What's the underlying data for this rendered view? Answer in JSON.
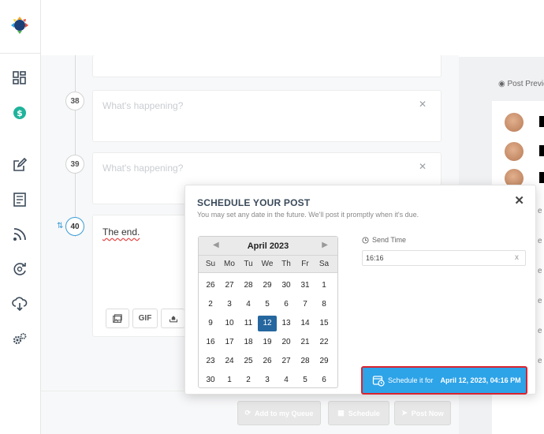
{
  "sidebar": {
    "icons": [
      "app-logo-icon",
      "dashboard-icon",
      "dollar-icon",
      "compose-icon",
      "queue-icon",
      "rss-icon",
      "recycle-icon",
      "cloud-download-icon",
      "settings-icon"
    ]
  },
  "posts": [
    {
      "number": "38",
      "placeholder": "What's happening?",
      "text": ""
    },
    {
      "number": "39",
      "placeholder": "What's happening?",
      "text": ""
    },
    {
      "number": "40",
      "placeholder": "",
      "text": "The end."
    }
  ],
  "composer_tools": {
    "gif_label": "GIF"
  },
  "bottom_actions": {
    "queue_label": "Add to my Queue",
    "schedule_label": "Schedule",
    "post_now_label": "Post Now"
  },
  "preview": {
    "title": "Post Preview"
  },
  "modal": {
    "title": "SCHEDULE YOUR POST",
    "subtitle": "You may set any date in the future. We'll post it promptly when it's due.",
    "calendar": {
      "month_label": "April 2023",
      "prev_arrow": "◀",
      "next_arrow": "▶",
      "weekdays": [
        "Su",
        "Mo",
        "Tu",
        "We",
        "Th",
        "Fr",
        "Sa"
      ],
      "weeks": [
        [
          "26",
          "27",
          "28",
          "29",
          "30",
          "31",
          "1"
        ],
        [
          "2",
          "3",
          "4",
          "5",
          "6",
          "7",
          "8"
        ],
        [
          "9",
          "10",
          "11",
          "12",
          "13",
          "14",
          "15"
        ],
        [
          "16",
          "17",
          "18",
          "19",
          "20",
          "21",
          "22"
        ],
        [
          "23",
          "24",
          "25",
          "26",
          "27",
          "28",
          "29"
        ],
        [
          "30",
          "1",
          "2",
          "3",
          "4",
          "5",
          "6"
        ]
      ],
      "selected_day": "12"
    },
    "send_time_label": "Send Time",
    "send_time_value": "16:16",
    "clear_label": "x",
    "close_label": "✕",
    "schedule_button_label": "Schedule it for",
    "schedule_button_date": "April 12, 2023, 04:16 PM"
  },
  "colors": {
    "accent": "#2da3e8",
    "selected_day": "#25679e",
    "highlight_border": "#d9232f"
  }
}
